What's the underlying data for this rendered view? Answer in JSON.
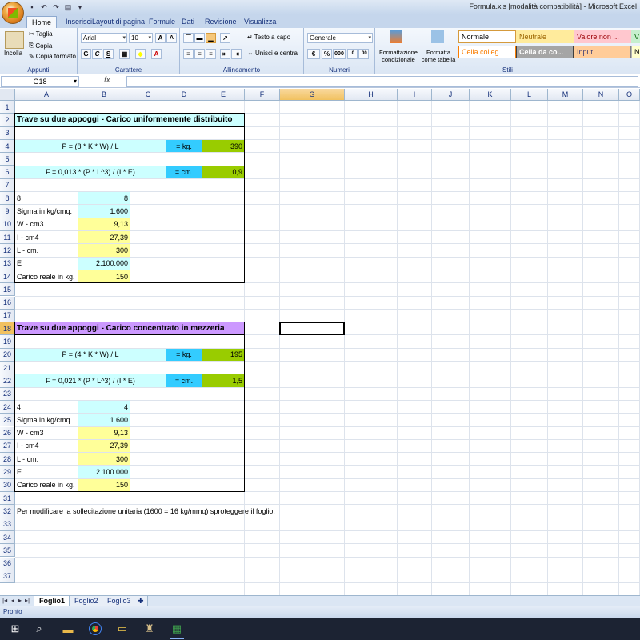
{
  "window": {
    "title": "Formula.xls  [modalità compatibilità]  - Microsoft Excel"
  },
  "ribbon": {
    "tabs": [
      "Home",
      "Inserisci",
      "Layout di pagina",
      "Formule",
      "Dati",
      "Revisione",
      "Visualizza"
    ],
    "clipboard": {
      "paste": "Incolla",
      "cut": "Taglia",
      "copy": "Copia",
      "format_painter": "Copia formato",
      "label": "Appunti"
    },
    "font": {
      "name": "Arial",
      "size": "10",
      "label": "Carattere",
      "bold": "G",
      "italic": "C",
      "underline": "S"
    },
    "alignment": {
      "wrap": "Testo a capo",
      "merge": "Unisci e centra",
      "label": "Allineamento"
    },
    "number": {
      "format": "Generale",
      "label": "Numeri",
      "percent": "%",
      "thousands": "000"
    },
    "styles": {
      "conditional": "Formattazione condizionale",
      "table": "Formatta come tabella",
      "label": "Stili",
      "boxes": [
        {
          "label": "Normale",
          "bg": "#ffffff",
          "color": "#000000",
          "border": "#d59a3c"
        },
        {
          "label": "Neutrale",
          "bg": "#ffeb9c",
          "color": "#9c6500",
          "border": "#ffeb9c"
        },
        {
          "label": "Valore non ...",
          "bg": "#ffc7ce",
          "color": "#9c0006",
          "border": "#ffc7ce"
        },
        {
          "label": "V",
          "bg": "#c6efce",
          "color": "#006100",
          "border": "#c6efce"
        },
        {
          "label": "Cella colleg...",
          "bg": "#ffffff",
          "color": "#fa7d00",
          "border": "#fa7d00"
        },
        {
          "label": "Cella da co...",
          "bg": "#a5a5a5",
          "color": "#ffffff",
          "border": "#3f3f3f"
        },
        {
          "label": "Input",
          "bg": "#ffcc99",
          "color": "#3f3f76",
          "border": "#7f7f7f"
        },
        {
          "label": "N",
          "bg": "#ffffcc",
          "color": "#000000",
          "border": "#b2b2b2"
        }
      ]
    }
  },
  "formula_bar": {
    "name_box": "G18",
    "fx": "fx",
    "value": ""
  },
  "columns": [
    "A",
    "B",
    "C",
    "D",
    "E",
    "F",
    "G",
    "H",
    "I",
    "J",
    "K",
    "L",
    "M",
    "N",
    "O"
  ],
  "selected_column": "G",
  "rows": [
    "1",
    "2",
    "3",
    "4",
    "5",
    "6",
    "7",
    "8",
    "9",
    "10",
    "11",
    "12",
    "13",
    "14",
    "15",
    "16",
    "17",
    "18",
    "19",
    "20",
    "21",
    "22",
    "23",
    "24",
    "25",
    "26",
    "27",
    "28",
    "29",
    "30",
    "31",
    "32",
    "33",
    "34",
    "35",
    "36",
    "37"
  ],
  "selected_row": "18",
  "sheet": {
    "title1": "Trave su due appoggi - Carico uniformemente distribuito",
    "formula_p1": "P = (8 * K * W) / L",
    "unit_kg": "= kg.",
    "result_p1": "390",
    "formula_f1": "F = 0,013 * (P * L^3) / (I * E)",
    "unit_cm": "= cm.",
    "result_f1": "0,9",
    "k_label1": "8",
    "k_value1": "8",
    "labels": [
      "Sigma in kg/cmq.",
      "W - cm3",
      "I - cm4",
      "L - cm.",
      "E",
      "Carico reale in kg."
    ],
    "values1": [
      "1.600",
      "9,13",
      "27,39",
      "300",
      "2.100.000",
      "150"
    ],
    "title2": "Trave su due appoggi - Carico concentrato in mezzeria",
    "formula_p2": "P = (4 * K * W) / L",
    "result_p2": "195",
    "formula_f2": "F = 0,021 * (P * L^3) / (I * E)",
    "result_f2": "1,5",
    "k_label2": "4",
    "k_value2": "4",
    "values2": [
      "1.600",
      "9,13",
      "27,39",
      "300",
      "2.100.000",
      "150"
    ],
    "note": "Per modificare la sollecitazione unitaria (1600 = 16 kg/mmq) sproteggere il foglio."
  },
  "sheet_tabs": [
    "Foglio1",
    "Foglio2",
    "Foglio3"
  ],
  "status": "Pronto"
}
